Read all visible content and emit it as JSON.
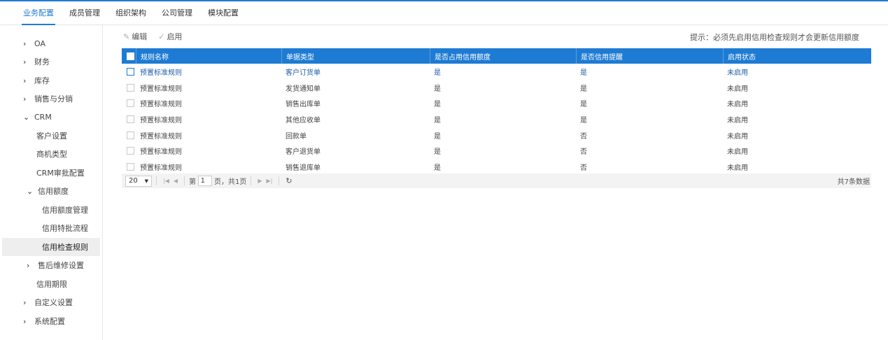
{
  "topnav": {
    "tabs": [
      {
        "label": "业务配置",
        "active": true
      },
      {
        "label": "成员管理",
        "active": false
      },
      {
        "label": "组织架构",
        "active": false
      },
      {
        "label": "公司管理",
        "active": false
      },
      {
        "label": "模块配置",
        "active": false
      }
    ]
  },
  "sidebar": {
    "items": [
      {
        "label": "OA",
        "arrow": "›"
      },
      {
        "label": "财务",
        "arrow": "›"
      },
      {
        "label": "库存",
        "arrow": "›"
      },
      {
        "label": "销售与分销",
        "arrow": "›"
      },
      {
        "label": "CRM",
        "arrow": "⌄"
      },
      {
        "label": "客户设置"
      },
      {
        "label": "商机类型"
      },
      {
        "label": "CRM审批配置"
      },
      {
        "label": "信用额度",
        "arrow": "⌄"
      },
      {
        "label": "信用额度管理"
      },
      {
        "label": "信用特批流程"
      },
      {
        "label": "信用检查规则",
        "active": true
      },
      {
        "label": "售后维修设置",
        "arrow": "›"
      },
      {
        "label": "信用期限"
      },
      {
        "label": "自定义设置",
        "arrow": "›"
      },
      {
        "label": "系统配置",
        "arrow": "›"
      }
    ]
  },
  "toolbar": {
    "edit_label": "编辑",
    "enable_label": "启用",
    "hint": "提示：必须先启用信用检查规则才会更新信用额度"
  },
  "grid": {
    "columns": [
      "规则名称",
      "单据类型",
      "是否占用信用额度",
      "是否信用提醒",
      "启用状态"
    ],
    "rows": [
      [
        "预置标准规则",
        "客户订货单",
        "是",
        "是",
        "未启用"
      ],
      [
        "预置标准规则",
        "发货通知单",
        "是",
        "是",
        "未启用"
      ],
      [
        "预置标准规则",
        "销售出库单",
        "是",
        "是",
        "未启用"
      ],
      [
        "预置标准规则",
        "其他应收单",
        "是",
        "是",
        "未启用"
      ],
      [
        "预置标准规则",
        "回款单",
        "是",
        "否",
        "未启用"
      ],
      [
        "预置标准规则",
        "客户退货单",
        "是",
        "否",
        "未启用"
      ],
      [
        "预置标准规则",
        "销售退库单",
        "是",
        "否",
        "未启用"
      ]
    ],
    "selected_row": 0
  },
  "pager": {
    "page_size": "20",
    "page_prefix": "第",
    "page_value": "1",
    "page_suffix": "页，共1页",
    "total": "共7条数据"
  },
  "colors": {
    "accent": "#1e7bd3",
    "selected_text": "#1e5fa8",
    "active_bg": "#eeeeee"
  }
}
